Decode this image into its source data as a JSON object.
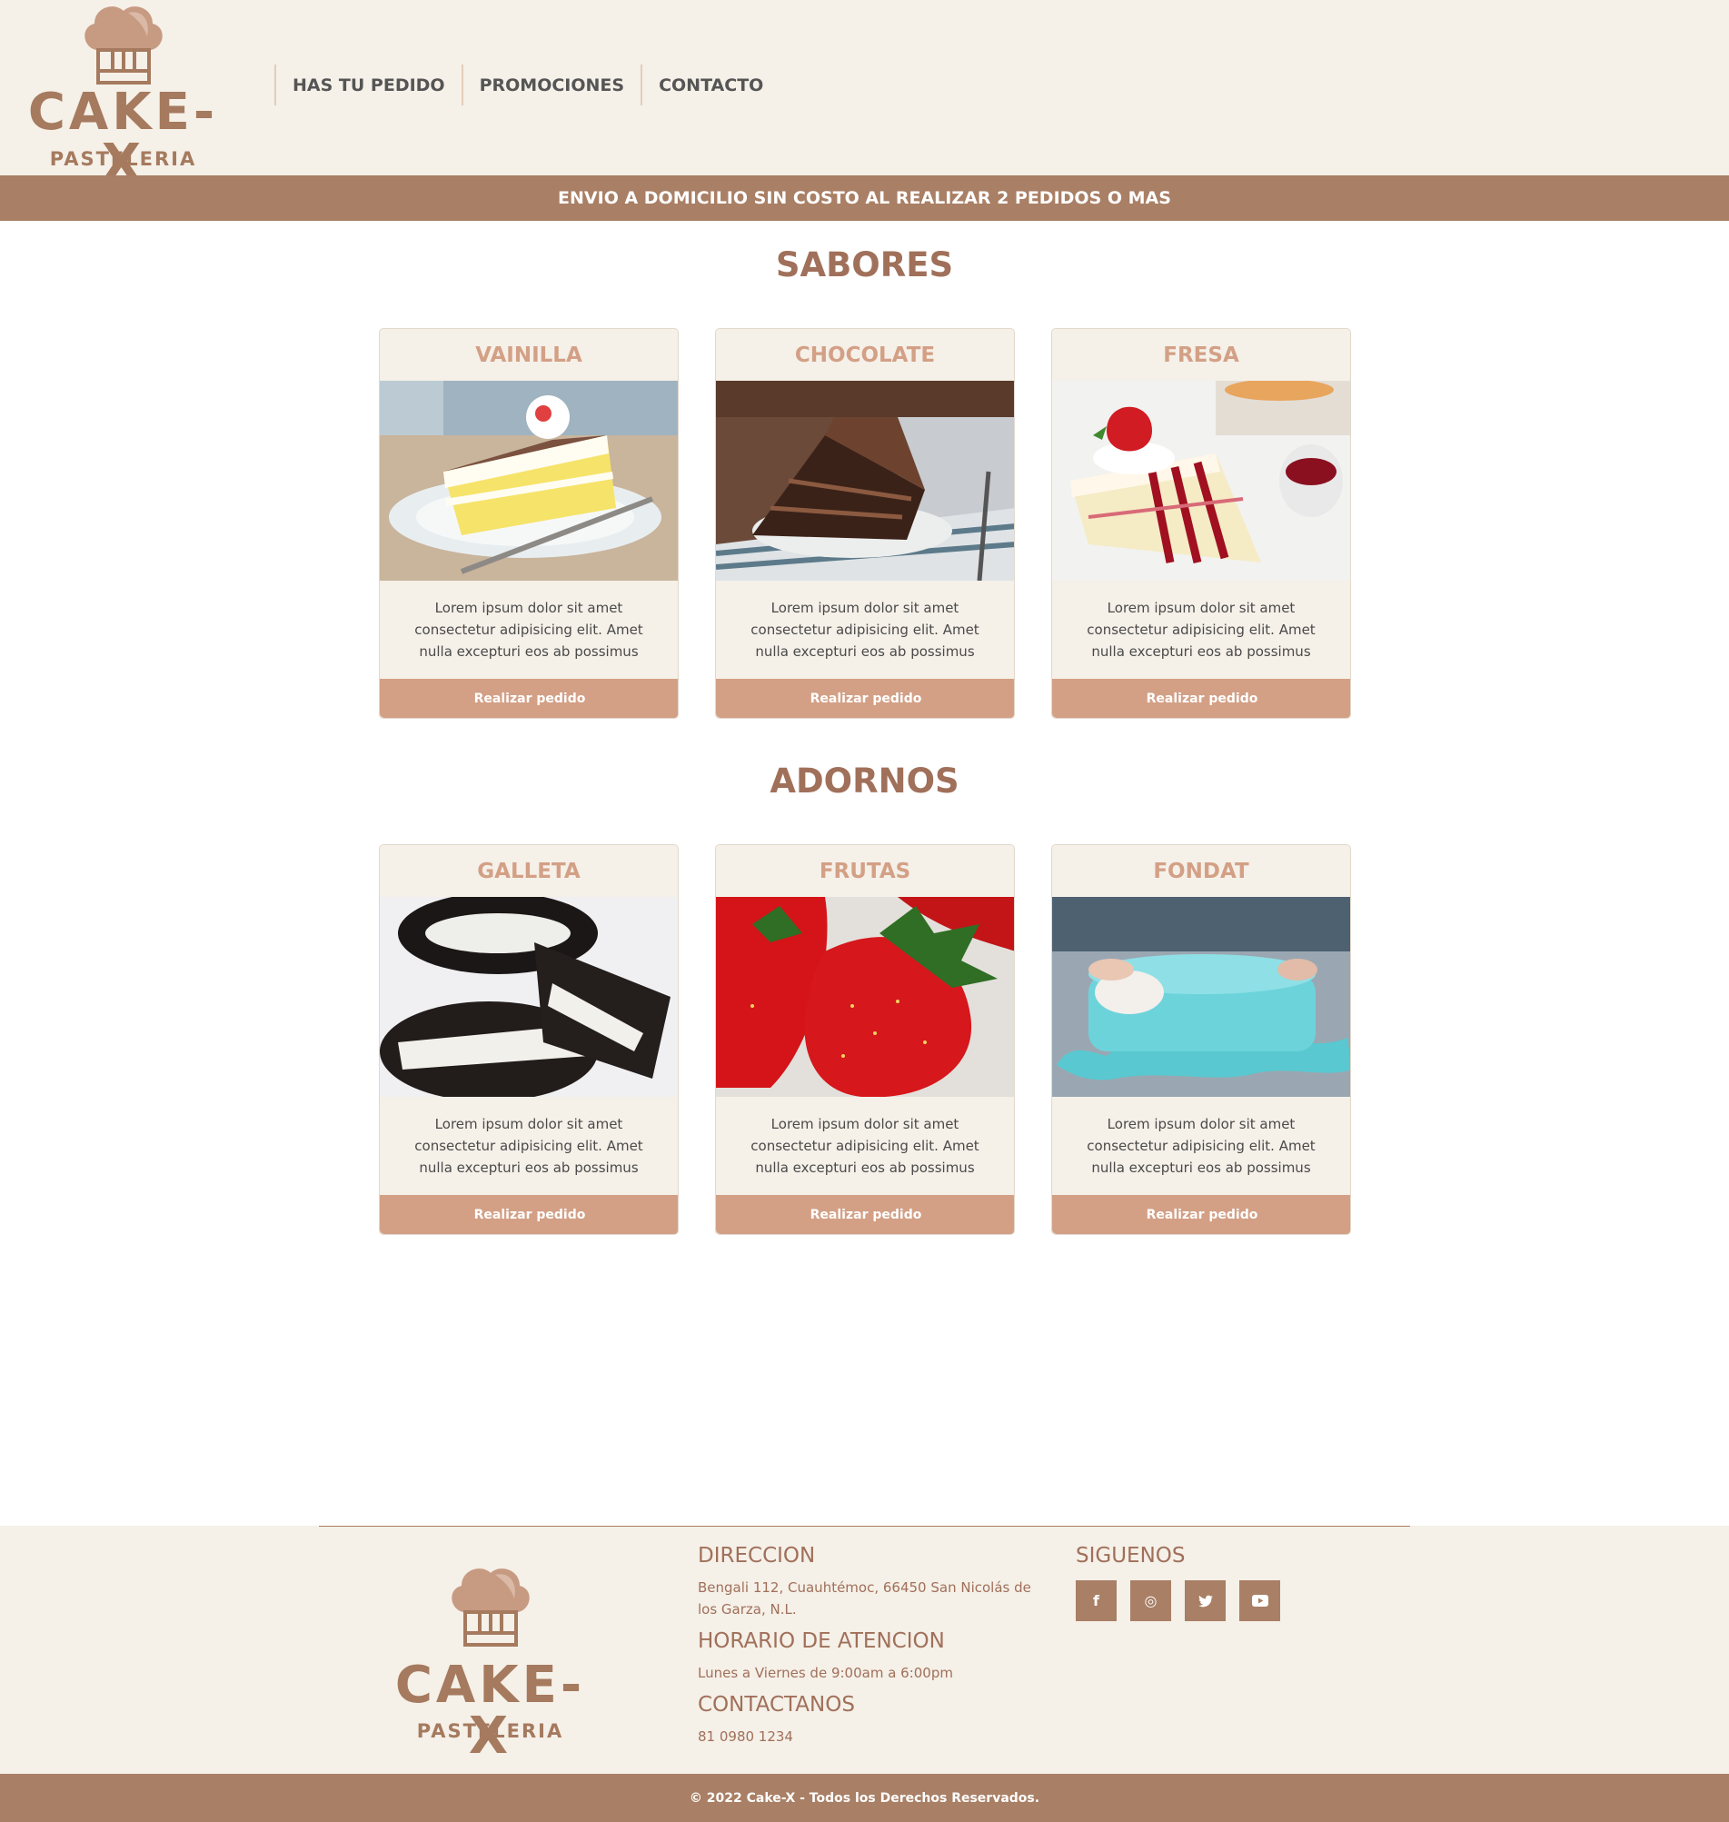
{
  "brand": {
    "name": "CAKE-X",
    "subtitle": "PASTELERIA"
  },
  "nav": {
    "items": [
      "HAS TU PEDIDO",
      "PROMOCIONES",
      "CONTACTO"
    ]
  },
  "banner": "ENVIO A DOMICILIO SIN COSTO AL REALIZAR 2 PEDIDOS O MAS",
  "sections": [
    {
      "title": "SABORES",
      "cards": [
        {
          "title": "VAINILLA",
          "text": "Lorem ipsum dolor sit amet consectetur adipisicing elit. Amet nulla excepturi eos ab possimus",
          "button": "Realizar pedido",
          "image": "vanilla-cake-slice"
        },
        {
          "title": "CHOCOLATE",
          "text": "Lorem ipsum dolor sit amet consectetur adipisicing elit. Amet nulla excepturi eos ab possimus",
          "button": "Realizar pedido",
          "image": "chocolate-cake-slice"
        },
        {
          "title": "FRESA",
          "text": "Lorem ipsum dolor sit amet consectetur adipisicing elit. Amet nulla excepturi eos ab possimus",
          "button": "Realizar pedido",
          "image": "strawberry-cake-slice"
        }
      ]
    },
    {
      "title": "ADORNOS",
      "cards": [
        {
          "title": "GALLETA",
          "text": "Lorem ipsum dolor sit amet consectetur adipisicing elit. Amet nulla excepturi eos ab possimus",
          "button": "Realizar pedido",
          "image": "sandwich-cookies"
        },
        {
          "title": "FRUTAS",
          "text": "Lorem ipsum dolor sit amet consectetur adipisicing elit. Amet nulla excepturi eos ab possimus",
          "button": "Realizar pedido",
          "image": "strawberries"
        },
        {
          "title": "FONDAT",
          "text": "Lorem ipsum dolor sit amet consectetur adipisicing elit. Amet nulla excepturi eos ab possimus",
          "button": "Realizar pedido",
          "image": "fondant-cake"
        }
      ]
    }
  ],
  "footer": {
    "direccion_title": "DIRECCION",
    "direccion_text": "Bengali 112, Cuauhtémoc, 66450 San Nicolás de los Garza, N.L.",
    "horario_title": "HORARIO DE ATENCION",
    "horario_text": "Lunes a Viernes de 9:00am a 6:00pm",
    "contacto_title": "CONTACTANOS",
    "contacto_text": "81 0980 1234",
    "siguenos_title": "SIGUENOS",
    "social": [
      {
        "icon": "facebook-icon",
        "glyph": "f"
      },
      {
        "icon": "instagram-icon",
        "glyph": "◎"
      },
      {
        "icon": "twitter-icon",
        "glyph": "🐦"
      },
      {
        "icon": "youtube-icon",
        "glyph": "▶"
      }
    ],
    "copyright": "© 2022 Cake-X - Todos los Derechos Reservados."
  },
  "colors": {
    "brand": "#a97f65",
    "accent": "#d3a086",
    "cream": "#f5f0e8"
  }
}
